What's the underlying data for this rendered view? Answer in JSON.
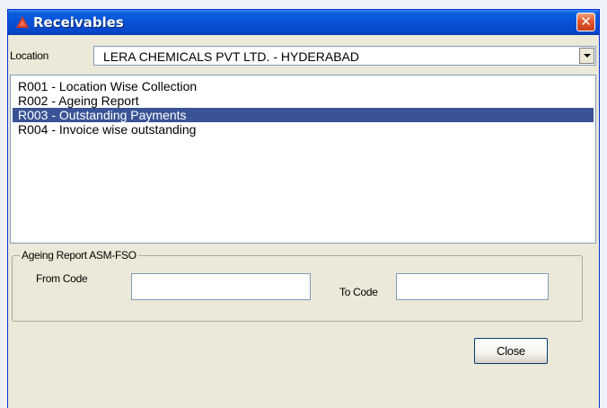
{
  "window": {
    "title": "Receivables",
    "close_glyph": "✕"
  },
  "location": {
    "label": "Location",
    "value": "LERA CHEMICALS PVT LTD. - HYDERABAD"
  },
  "reports": {
    "items": [
      {
        "label": "R001 - Location Wise Collection"
      },
      {
        "label": "R002 - Ageing Report"
      },
      {
        "label": "R003 - Outstanding Payments"
      },
      {
        "label": "R004 - Invoice wise outstanding"
      }
    ],
    "selected_index": 2
  },
  "ageing_group": {
    "legend": "Ageing Report ASM-FSO",
    "from_label": "From Code",
    "from_value": "",
    "to_label": "To Code",
    "to_value": ""
  },
  "buttons": {
    "close_label": "Close"
  },
  "colors": {
    "titlebar": "#0851d6",
    "selection": "#3a5396",
    "window_face": "#ece9d8"
  },
  "icons": {
    "app": "app-icon",
    "close": "close-icon",
    "dropdown": "chevron-down-icon"
  }
}
